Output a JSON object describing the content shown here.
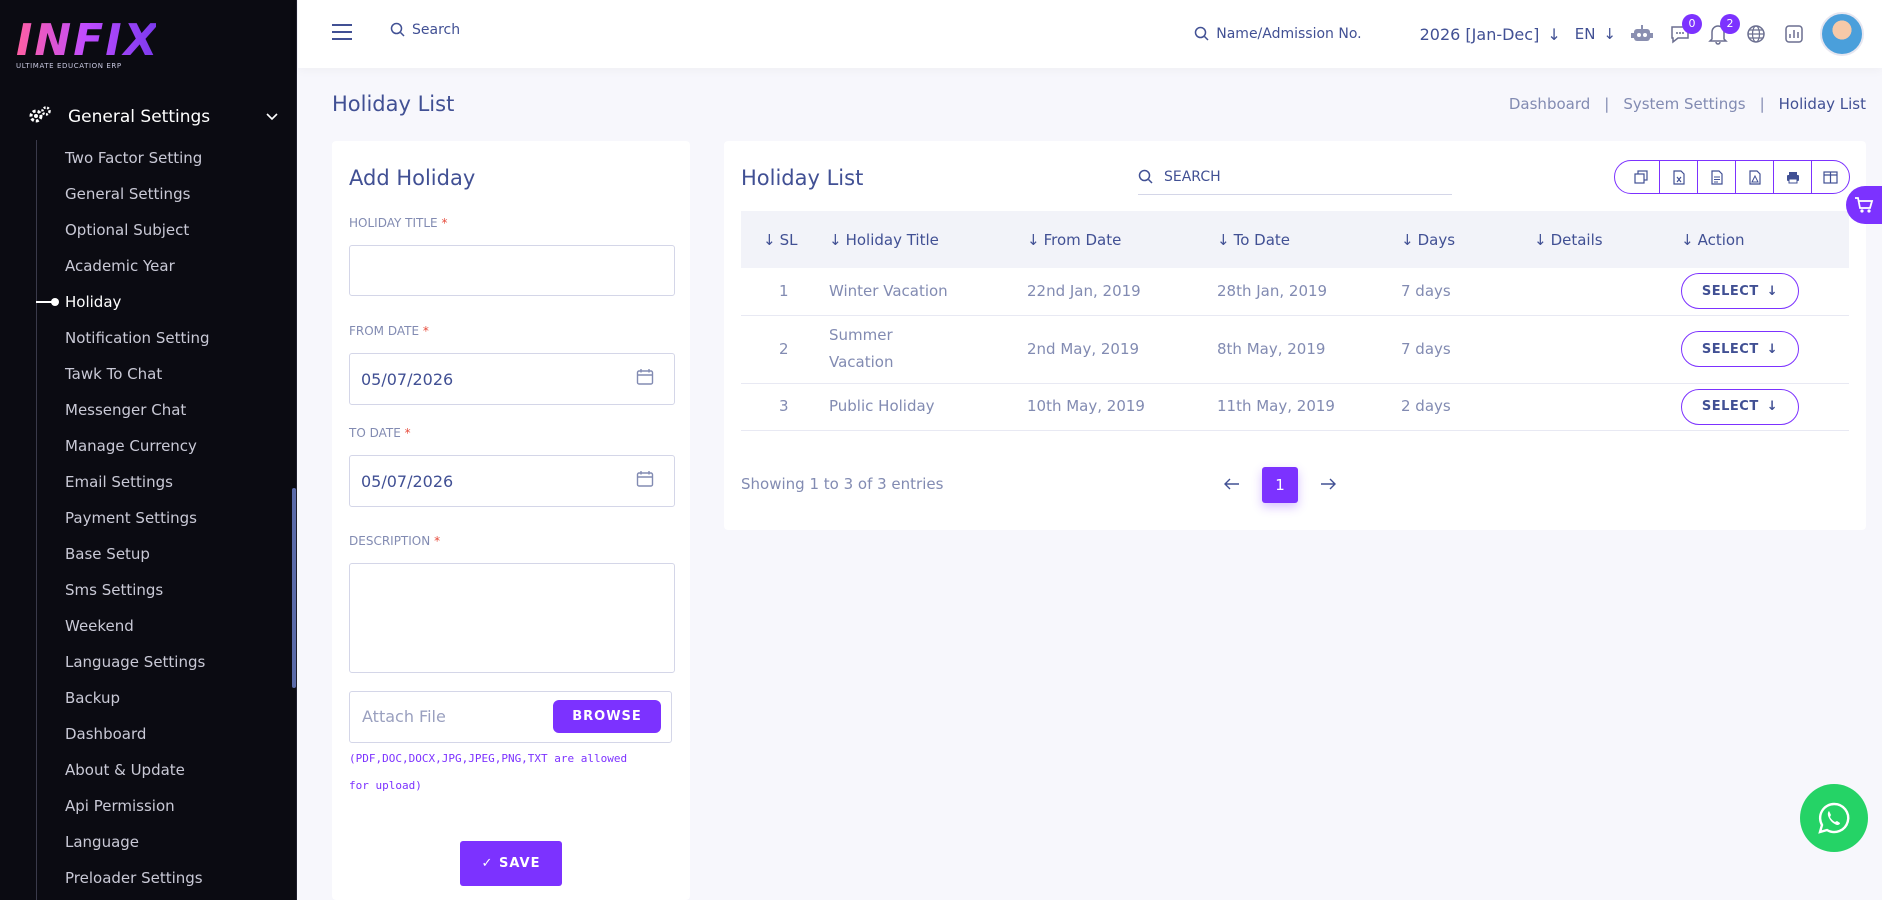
{
  "brand": {
    "logo_text": "INFIX",
    "tagline": "ULTIMATE EDUCATION ERP"
  },
  "sidebar": {
    "group_title": "General Settings",
    "items": [
      {
        "label": "Two Factor Setting",
        "active": false
      },
      {
        "label": "General Settings",
        "active": false
      },
      {
        "label": "Optional Subject",
        "active": false
      },
      {
        "label": "Academic Year",
        "active": false
      },
      {
        "label": "Holiday",
        "active": true
      },
      {
        "label": "Notification Setting",
        "active": false
      },
      {
        "label": "Tawk To Chat",
        "active": false
      },
      {
        "label": "Messenger Chat",
        "active": false
      },
      {
        "label": "Manage Currency",
        "active": false
      },
      {
        "label": "Email Settings",
        "active": false
      },
      {
        "label": "Payment Settings",
        "active": false
      },
      {
        "label": "Base Setup",
        "active": false
      },
      {
        "label": "Sms Settings",
        "active": false
      },
      {
        "label": "Weekend",
        "active": false
      },
      {
        "label": "Language Settings",
        "active": false
      },
      {
        "label": "Backup",
        "active": false
      },
      {
        "label": "Dashboard",
        "active": false
      },
      {
        "label": "About & Update",
        "active": false
      },
      {
        "label": "Api Permission",
        "active": false
      },
      {
        "label": "Language",
        "active": false
      },
      {
        "label": "Preloader Settings",
        "active": false
      }
    ]
  },
  "topbar": {
    "search_placeholder": "Search",
    "student_search_placeholder": "Name/Admission No.",
    "academic_year": "2026 [Jan-Dec]",
    "language": "EN",
    "messages_count": "0",
    "notifications_count": "2"
  },
  "page": {
    "title": "Holiday List",
    "breadcrumb": [
      "Dashboard",
      "System Settings",
      "Holiday List"
    ]
  },
  "add_form": {
    "title": "Add Holiday",
    "holiday_title_label": "HOLIDAY TITLE",
    "holiday_title_value": "",
    "from_date_label": "FROM DATE",
    "from_date_value": "05/07/2026",
    "to_date_label": "TO DATE",
    "to_date_value": "05/07/2026",
    "description_label": "DESCRIPTION",
    "description_value": "",
    "attach_placeholder": "Attach File",
    "browse_label": "BROWSE",
    "file_note": "(PDF,DOC,DOCX,JPG,JPEG,PNG,TXT are allowed for upload)",
    "save_label": "SAVE",
    "required_mark": "*"
  },
  "list": {
    "title": "Holiday List",
    "search_placeholder": "SEARCH",
    "columns": [
      "SL",
      "Holiday Title",
      "From Date",
      "To Date",
      "Days",
      "Details",
      "Action"
    ],
    "rows": [
      {
        "sl": "1",
        "title": "Winter Vacation",
        "from": "22nd Jan, 2019",
        "to": "28th Jan, 2019",
        "days": "7 days",
        "details": "",
        "action": "SELECT"
      },
      {
        "sl": "2",
        "title": "Summer Vacation",
        "from": "2nd May, 2019",
        "to": "8th May, 2019",
        "days": "7 days",
        "details": "",
        "action": "SELECT"
      },
      {
        "sl": "3",
        "title": "Public Holiday",
        "from": "10th May, 2019",
        "to": "11th May, 2019",
        "days": "2 days",
        "details": "",
        "action": "SELECT"
      }
    ],
    "showing_text": "Showing 1 to 3 of 3 entries",
    "current_page": "1"
  },
  "colors": {
    "accent": "#7c32ff",
    "text": "#415094",
    "muted": "#828bb2",
    "sidebar_bg": "#0b0b12",
    "whatsapp": "#25d366"
  },
  "icons": [
    "menu-icon",
    "search-icon",
    "robot-icon",
    "chat-icon",
    "bell-icon",
    "globe-icon",
    "chart-icon",
    "calendar-icon",
    "copy-icon",
    "excel-icon",
    "csv-icon",
    "pdf-icon",
    "print-icon",
    "columns-icon",
    "cart-icon",
    "whatsapp-icon"
  ]
}
